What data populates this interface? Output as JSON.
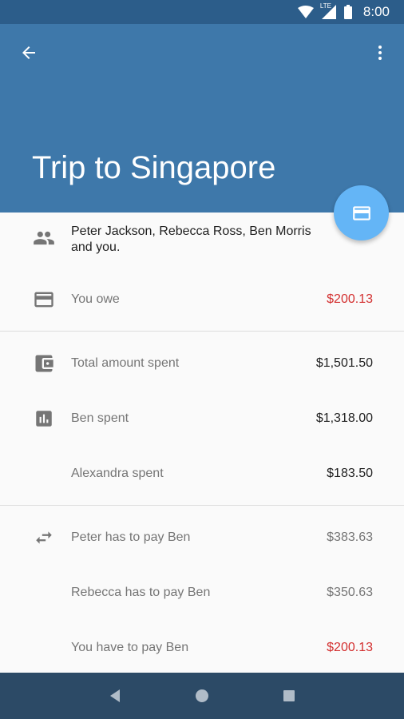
{
  "status_bar": {
    "time": "8:00",
    "network": "LTE"
  },
  "header": {
    "title": "Trip to Singapore"
  },
  "participants": {
    "text": "Peter Jackson, Rebecca Ross, Ben Morris and you."
  },
  "owe": {
    "label": "You owe",
    "value": "$200.13"
  },
  "spending": [
    {
      "label": "Total amount spent",
      "value": "$1,501.50"
    },
    {
      "label": "Ben spent",
      "value": "$1,318.00"
    },
    {
      "label": "Alexandra spent",
      "value": "$183.50"
    }
  ],
  "settlements": [
    {
      "label": "Peter has to pay Ben",
      "value": "$383.63"
    },
    {
      "label": "Rebecca has to pay Ben",
      "value": "$350.63"
    },
    {
      "label": "You have to pay Ben",
      "value": "$200.13"
    }
  ],
  "colors": {
    "app_bar": "#3e78aa",
    "status_bar": "#2c5d8a",
    "fab": "#64b5f6",
    "debt": "#d32f2f",
    "nav_bar": "#2c4a66"
  }
}
